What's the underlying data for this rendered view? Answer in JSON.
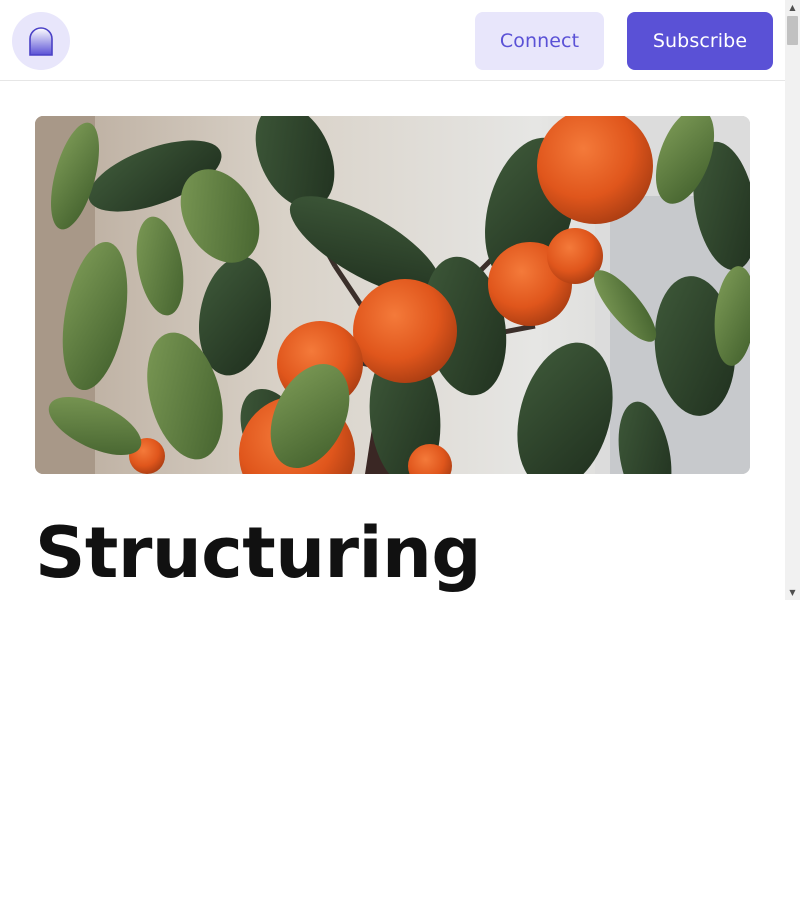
{
  "header": {
    "logo_icon": "arch-logo-icon",
    "connect_label": "Connect",
    "subscribe_label": "Subscribe"
  },
  "hero": {
    "image_subject": "orange-tree-photo"
  },
  "post": {
    "title": "Structuring"
  },
  "colors": {
    "accent": "#5a51d6",
    "accent_light": "#e8e6fb",
    "text": "#111111",
    "border": "#e6e6e6"
  },
  "scrollbar": {
    "up_icon": "scroll-up-arrow-icon",
    "down_icon": "scroll-down-arrow-icon"
  }
}
